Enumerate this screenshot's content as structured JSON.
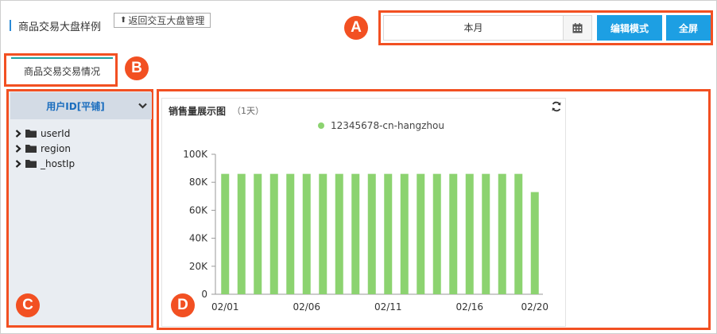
{
  "header": {
    "title": "商品交易大盘样例",
    "back_label": "返回交互大盘管理"
  },
  "controls": {
    "date_value": "本月",
    "edit_label": "编辑模式",
    "fullscreen_label": "全屏"
  },
  "badges": [
    "A",
    "B",
    "C",
    "D"
  ],
  "tabs": [
    {
      "label": "商品交易交易情况",
      "active": true
    }
  ],
  "sidebar": {
    "header": "用户ID[平铺]",
    "items": [
      {
        "label": "userId",
        "icon": "folder-icon"
      },
      {
        "label": "region",
        "icon": "folder-icon"
      },
      {
        "label": "_hostIp",
        "icon": "folder-icon"
      }
    ]
  },
  "chart": {
    "title": "销售量展示图",
    "subtitle": "（1天）",
    "legend": "12345678-cn-hangzhou",
    "color": "#8cd370"
  },
  "chart_data": {
    "type": "bar",
    "categories": [
      "02/01",
      "02/02",
      "02/03",
      "02/04",
      "02/05",
      "02/06",
      "02/07",
      "02/08",
      "02/09",
      "02/10",
      "02/11",
      "02/12",
      "02/13",
      "02/14",
      "02/15",
      "02/16",
      "02/17",
      "02/18",
      "02/19",
      "02/20"
    ],
    "x_tick_labels": [
      "02/01",
      "02/06",
      "02/11",
      "02/16",
      "02/20"
    ],
    "series": [
      {
        "name": "12345678-cn-hangzhou",
        "values": [
          86000,
          86000,
          86000,
          86000,
          86000,
          86000,
          86000,
          86000,
          86000,
          86000,
          86000,
          86000,
          86000,
          86000,
          86000,
          86000,
          86000,
          86000,
          86000,
          73000
        ]
      }
    ],
    "y_ticks": [
      "0",
      "20K",
      "40K",
      "60K",
      "80K",
      "100K"
    ],
    "ylim": [
      0,
      100000
    ],
    "grid": false,
    "legend_position": "top-center"
  }
}
